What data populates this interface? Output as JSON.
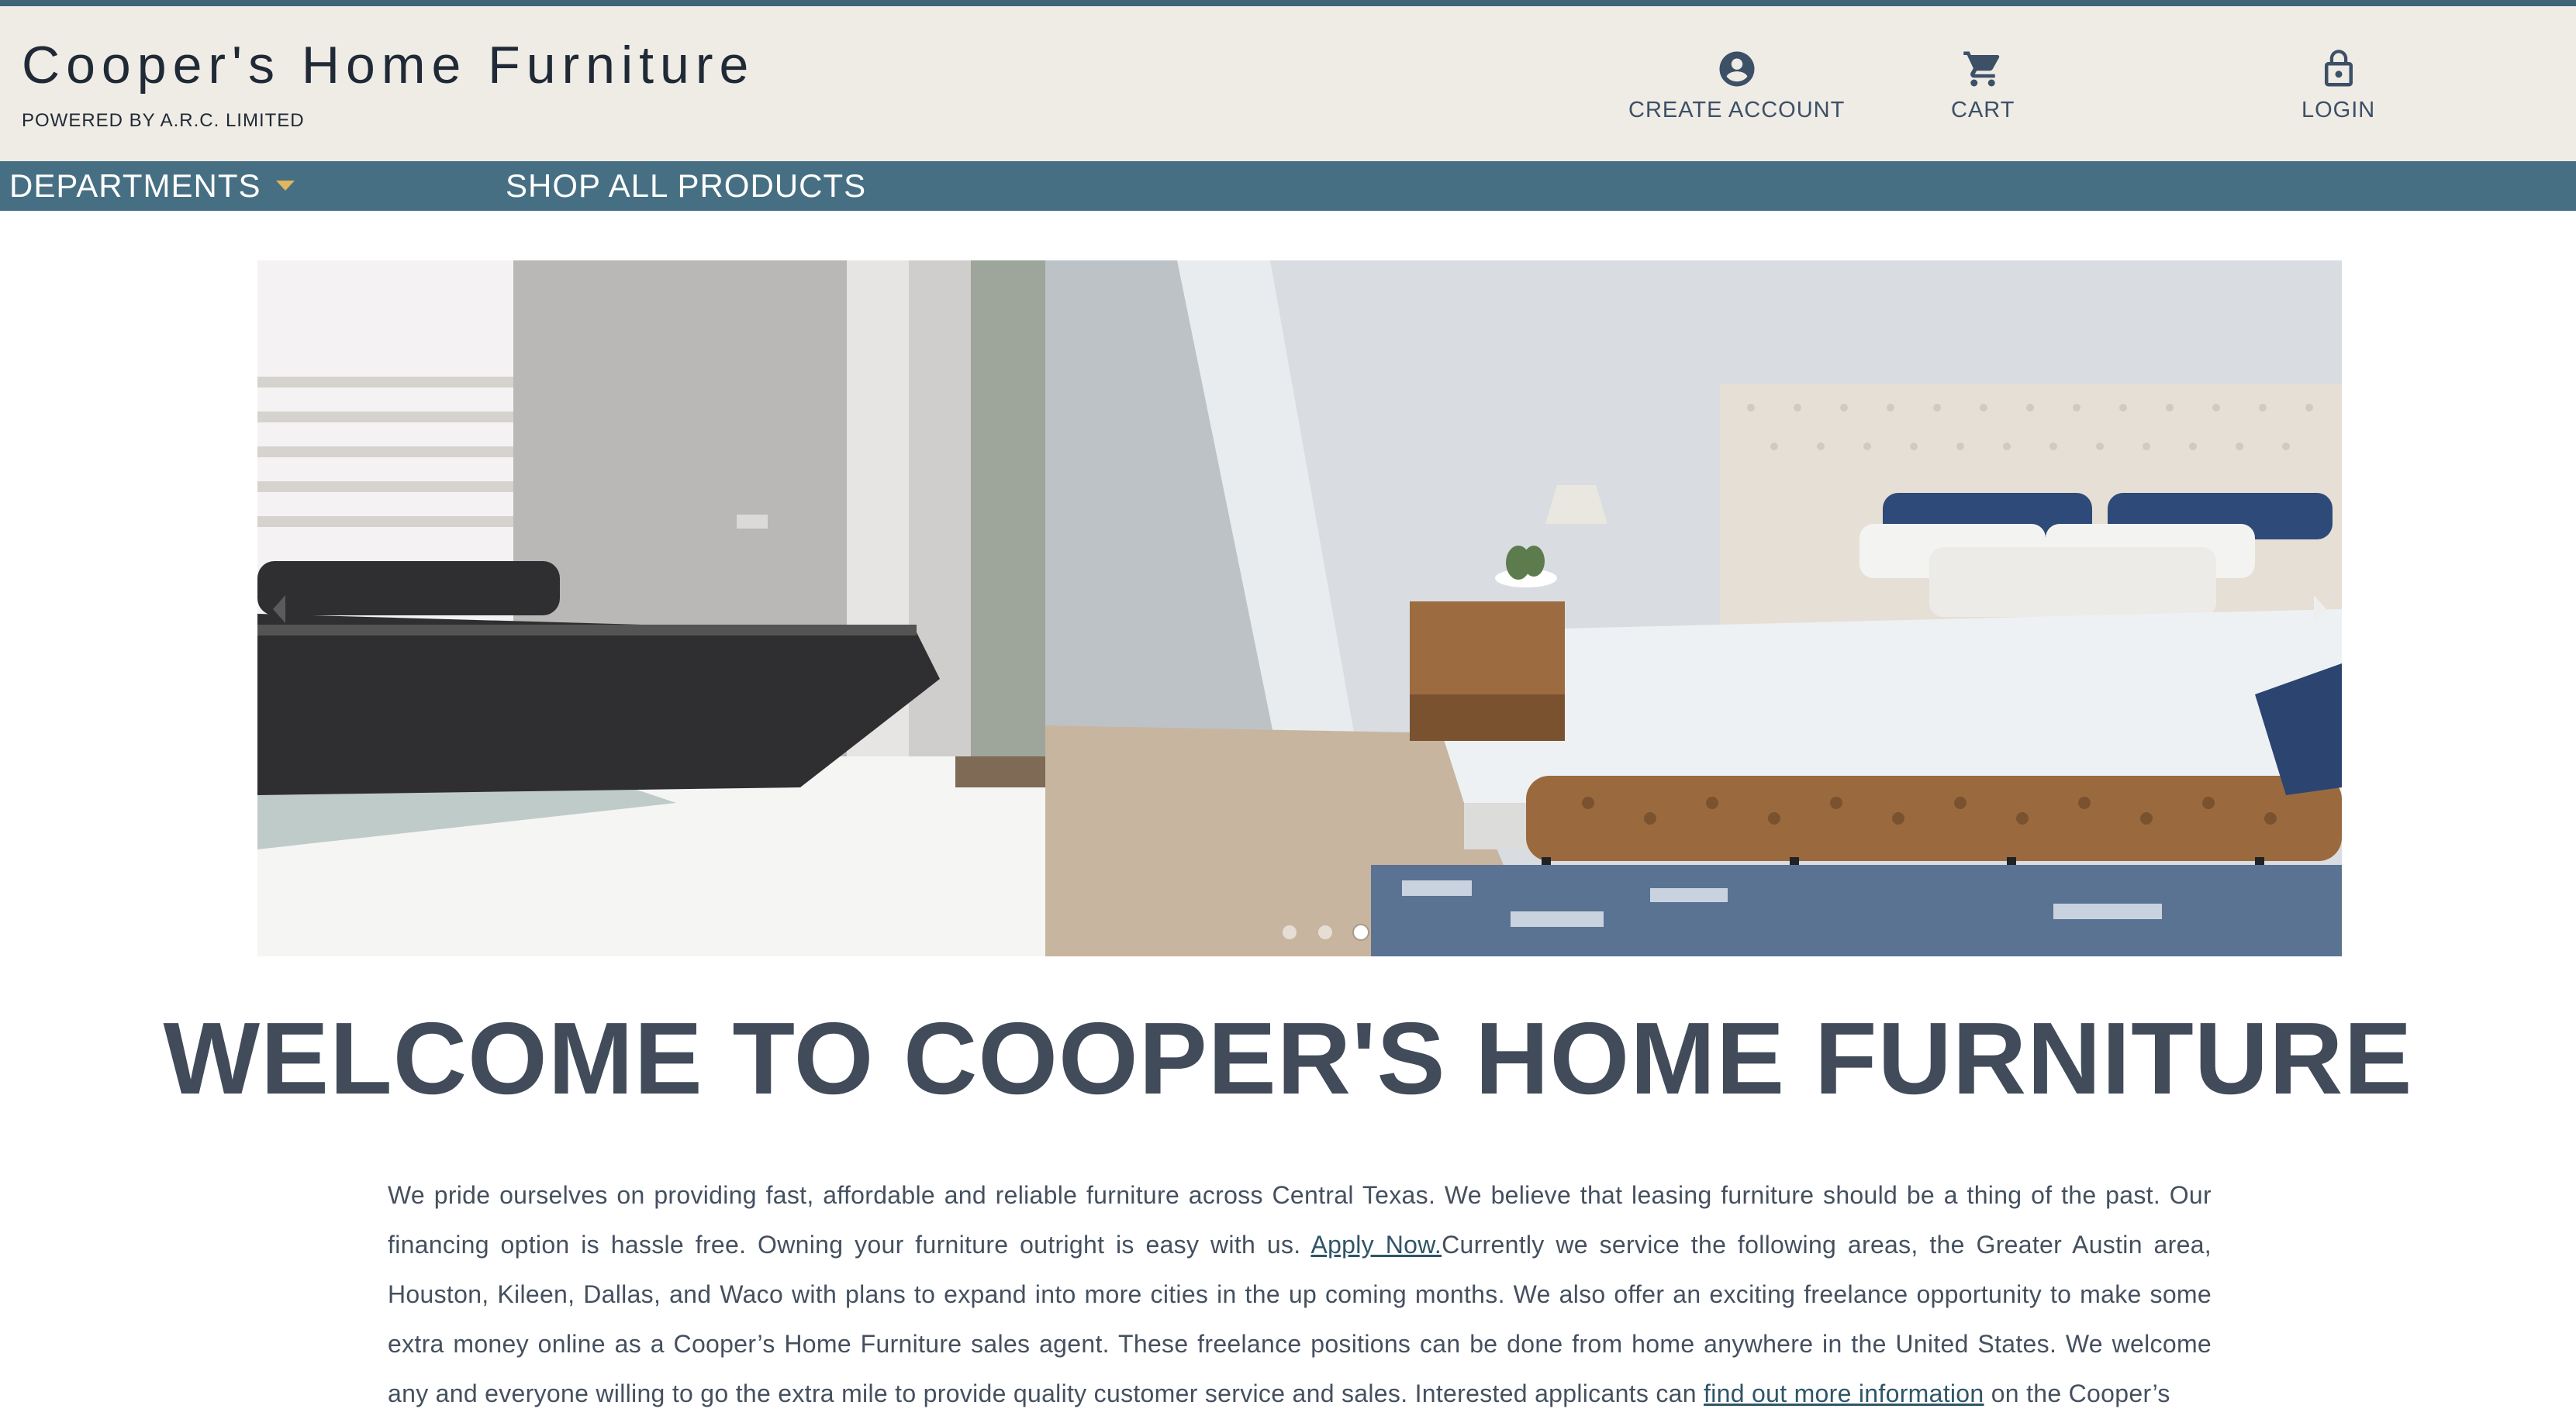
{
  "header": {
    "brand_title": "Cooper's Home Furniture",
    "brand_subtitle": "POWERED BY A.R.C. LIMITED",
    "nav": {
      "create_account": "CREATE ACCOUNT",
      "cart": "CART",
      "login": "LOGIN"
    }
  },
  "navbar": {
    "departments": "DEPARTMENTS",
    "shop_all": "SHOP ALL PRODUCTS"
  },
  "slider": {
    "slides": [
      {
        "subject": "living room with dark grey sofa and patterned rug"
      },
      {
        "subject": "bedroom with tufted headboard bed and leather bench"
      }
    ],
    "dot_count": 3,
    "active_dot": 3
  },
  "main": {
    "welcome_heading": "WELCOME TO COOPER'S HOME FURNITURE",
    "intro": {
      "part1": "We pride ourselves on providing fast, affordable and reliable furniture across Central Texas. We believe that leasing furniture should be a thing of the past. Our financing option is hassle free. Owning your furniture outright is easy with us. ",
      "apply_link": "Apply Now.",
      "part2": "Currently we service the following areas, the Greater Austin area, Houston, Kileen, Dallas, and Waco with plans to expand into more cities in the up coming months. We also offer an exciting freelance opportunity to make some extra money online as a Cooper’s Home Furniture sales agent. These freelance positions can be done from home anywhere in the United States. We welcome any and everyone willing to go the extra mile to provide quality customer service and sales. Interested applicants can ",
      "info_link": "find out more information",
      "part3": " on the Cooper’s"
    }
  },
  "colors": {
    "top_line": "#3f6478",
    "header_bg": "#efebe5",
    "navbar_bg": "#466f83",
    "caret": "#e2b55e",
    "text": "#45505f"
  }
}
